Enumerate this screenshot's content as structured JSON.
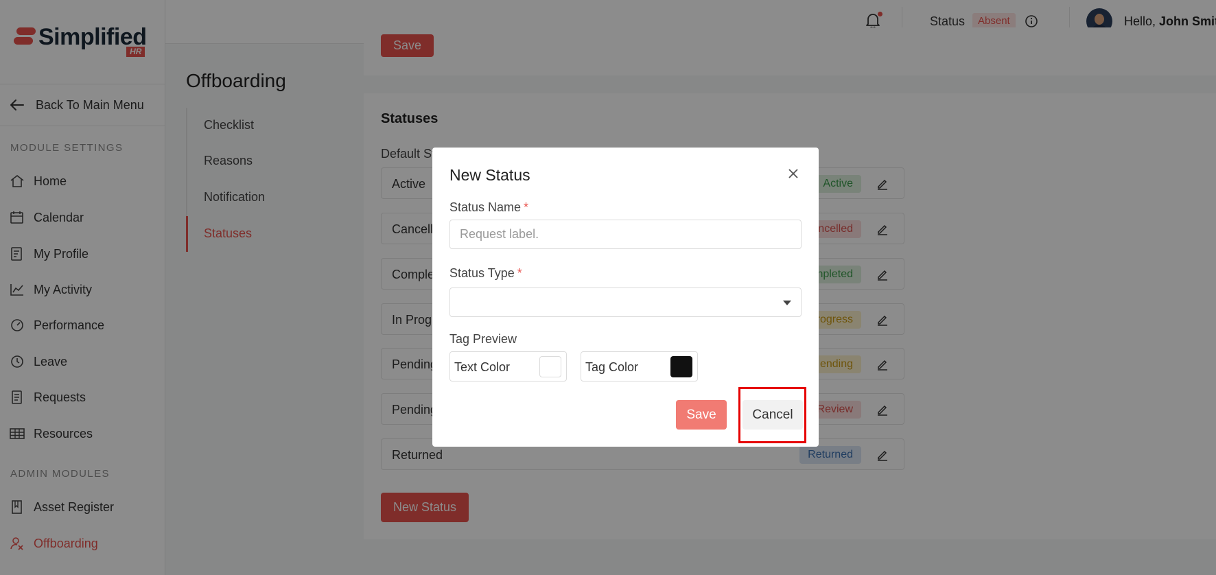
{
  "brand": {
    "name": "Simplified",
    "badge": "HR"
  },
  "sidebar": {
    "back_label": "Back To Main Menu",
    "module_settings_label": "MODULE SETTINGS",
    "admin_modules_label": "ADMIN MODULES",
    "items": [
      {
        "label": "Home",
        "icon": "home-icon"
      },
      {
        "label": "Calendar",
        "icon": "calendar-icon"
      },
      {
        "label": "My Profile",
        "icon": "profile-icon"
      },
      {
        "label": "My Activity",
        "icon": "activity-icon"
      },
      {
        "label": "Performance",
        "icon": "gauge-icon"
      },
      {
        "label": "Leave",
        "icon": "clock-icon"
      },
      {
        "label": "Requests",
        "icon": "document-icon"
      },
      {
        "label": "Resources",
        "icon": "grid-icon"
      }
    ],
    "admin_items": [
      {
        "label": "Asset Register",
        "icon": "book-icon"
      },
      {
        "label": "Offboarding",
        "icon": "offboarding-icon",
        "active": true
      }
    ]
  },
  "topbar": {
    "status_label": "Status",
    "status_value": "Absent",
    "greeting": "Hello,",
    "user_name": "John Smith"
  },
  "page": {
    "title": "Offboarding",
    "subnav": [
      "Checklist",
      "Reasons",
      "Notification",
      "Statuses"
    ],
    "active_subnav": "Statuses",
    "top_save_label": "Save",
    "card_title": "Statuses",
    "default_label": "Default St",
    "statuses": [
      {
        "name": "Active",
        "tag": "Active",
        "tag_color": "#3a9a4a",
        "tag_bg": "#dcefdc"
      },
      {
        "name": "Cancell",
        "tag": "ncelled",
        "tag_color": "#d9534f",
        "tag_bg": "#f9dcdc"
      },
      {
        "name": "Comple",
        "tag": "npleted",
        "tag_color": "#3a9a4a",
        "tag_bg": "#dcefdc"
      },
      {
        "name": "In Progr",
        "tag": "rogress",
        "tag_color": "#c99a14",
        "tag_bg": "#fbf0cc"
      },
      {
        "name": "Pending",
        "tag": "ending",
        "tag_color": "#c99a14",
        "tag_bg": "#fbf0cc"
      },
      {
        "name": "Pending",
        "tag": "Review",
        "tag_color": "#d9534f",
        "tag_bg": "#f9dcdc"
      },
      {
        "name": "Returned",
        "tag": "Returned",
        "tag_color": "#3b6fb0",
        "tag_bg": "#dbe6f5"
      }
    ],
    "new_status_label": "New Status"
  },
  "modal": {
    "title": "New Status",
    "status_name_label": "Status Name",
    "status_name_placeholder": "Request label.",
    "status_name_value": "",
    "status_type_label": "Status Type",
    "status_type_value": "",
    "tag_preview_label": "Tag Preview",
    "text_color_label": "Text Color",
    "text_color_value": "#ffffff",
    "tag_color_label": "Tag Color",
    "tag_color_value": "#111111",
    "save_label": "Save",
    "cancel_label": "Cancel"
  },
  "colors": {
    "accent": "#e8534e",
    "highlight": "#e60000"
  }
}
